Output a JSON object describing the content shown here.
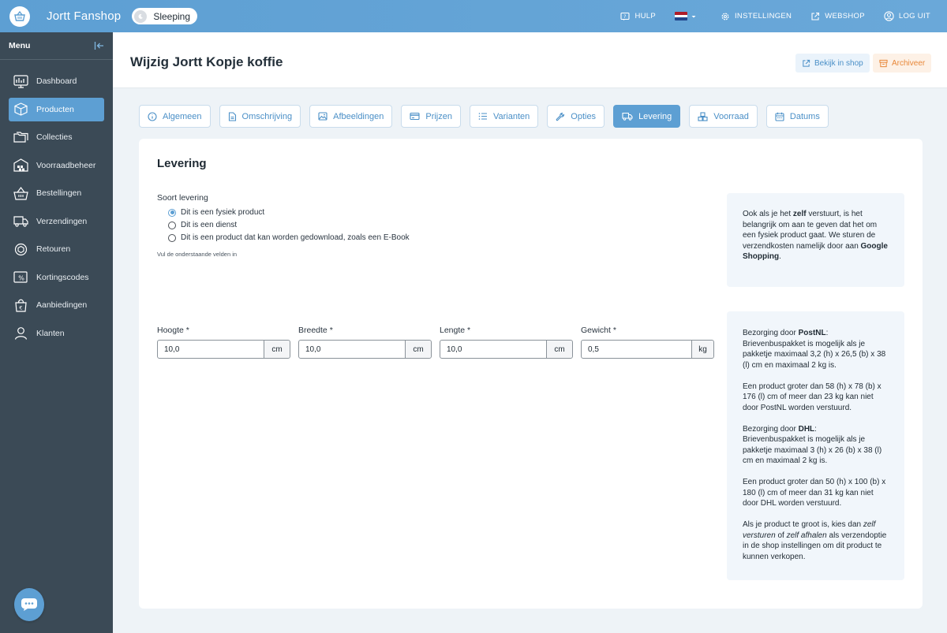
{
  "app": {
    "shop_name": "Jortt Fanshop",
    "status": "Sleeping"
  },
  "topnav": {
    "help": "HULP",
    "settings": "INSTELLINGEN",
    "webshop": "WEBSHOP",
    "logout": "LOG UIT"
  },
  "sidebar": {
    "menu_title": "Menu",
    "items": [
      {
        "label": "Dashboard"
      },
      {
        "label": "Producten",
        "active": true
      },
      {
        "label": "Collecties"
      },
      {
        "label": "Voorraadbeheer"
      },
      {
        "label": "Bestellingen"
      },
      {
        "label": "Verzendingen"
      },
      {
        "label": "Retouren"
      },
      {
        "label": "Kortingscodes"
      },
      {
        "label": "Aanbiedingen"
      },
      {
        "label": "Klanten"
      }
    ]
  },
  "header": {
    "title": "Wijzig Jortt Kopje koffie",
    "view_in_shop": "Bekijk in shop",
    "archive": "Archiveer"
  },
  "tabs": [
    {
      "label": "Algemeen"
    },
    {
      "label": "Omschrijving"
    },
    {
      "label": "Afbeeldingen"
    },
    {
      "label": "Prijzen"
    },
    {
      "label": "Varianten"
    },
    {
      "label": "Opties"
    },
    {
      "label": "Levering",
      "active": true
    },
    {
      "label": "Voorraad"
    },
    {
      "label": "Datums"
    }
  ],
  "card": {
    "title": "Levering",
    "delivery_type_label": "Soort levering",
    "options": [
      {
        "label": "Dit is een fysiek product",
        "checked": true
      },
      {
        "label": "Dit is een dienst",
        "checked": false
      },
      {
        "label": "Dit is een product dat kan worden gedownload, zoals een E-Book",
        "checked": false
      }
    ],
    "hint": "Vul de onderstaande velden in",
    "info1": {
      "pre": "Ook als je het ",
      "bold1": "zelf",
      "mid": " verstuurt, is het belangrijk om aan te geven dat het om een fysiek product gaat. We sturen de verzendkosten namelijk door aan ",
      "bold2": "Google Shopping",
      "post": "."
    },
    "dimensions": [
      {
        "label": "Hoogte *",
        "value": "10,0",
        "unit": "cm"
      },
      {
        "label": "Breedte *",
        "value": "10,0",
        "unit": "cm"
      },
      {
        "label": "Lengte *",
        "value": "10,0",
        "unit": "cm"
      },
      {
        "label": "Gewicht *",
        "value": "0,5",
        "unit": "kg"
      }
    ],
    "info2": {
      "postnl_pre": "Bezorging door ",
      "postnl_bold": "PostNL",
      "postnl_post": ":",
      "postnl_text": "Brievenbuspakket is mogelijk als je pakketje maximaal 3,2 (h) x 26,5 (b) x 38 (l) cm en maximaal 2 kg is.",
      "postnl_limit": "Een product groter dan 58 (h) x 78 (b) x 176 (l) cm of meer dan 23 kg kan niet door PostNL worden verstuurd.",
      "dhl_pre": "Bezorging door ",
      "dhl_bold": "DHL",
      "dhl_post": ":",
      "dhl_text": "Brievenbuspakket is mogelijk als je pakketje maximaal 3 (h) x 26 (b) x 38 (l) cm en maximaal 2 kg is.",
      "dhl_limit": "Een product groter dan 50 (h) x 100 (b) x 180 (l) cm of meer dan 31 kg kan niet door DHL worden verstuurd.",
      "big_pre": "Als je product te groot is, kies dan ",
      "big_em1": "zelf versturen",
      "big_mid": " of ",
      "big_em2": "zelf afhalen",
      "big_post": " als verzendoptie in de shop instellingen om dit product te kunnen verkopen."
    }
  },
  "colors": {
    "primary": "#5d9fd3",
    "sidebar": "#3b4a56",
    "archive": "#e8883a"
  }
}
